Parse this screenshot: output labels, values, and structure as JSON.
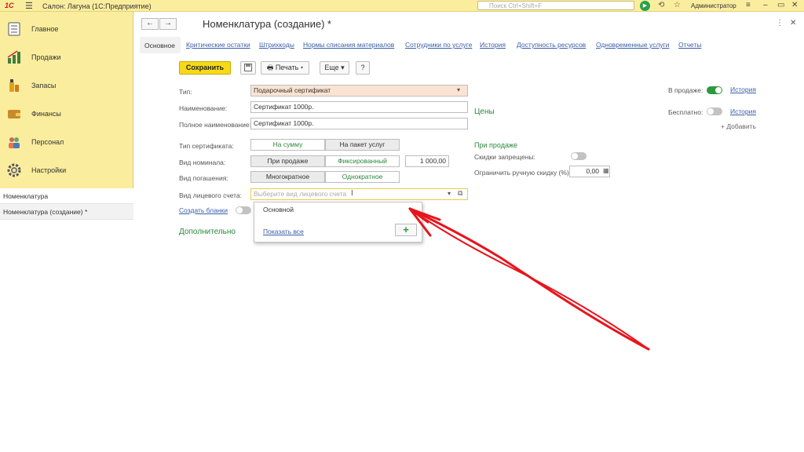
{
  "app": {
    "logo": "1С",
    "title": "Салон: Лагуна  (1С:Предприятие)",
    "search_placeholder": "Поиск Ctrl+Shift+F",
    "user": "Администратор"
  },
  "sidebar": {
    "items": [
      {
        "label": "Главное",
        "icon": "list-icon"
      },
      {
        "label": "Продажи",
        "icon": "bar-chart-icon"
      },
      {
        "label": "Запасы",
        "icon": "bottle-icon"
      },
      {
        "label": "Финансы",
        "icon": "wallet-icon"
      },
      {
        "label": "Персонал",
        "icon": "people-icon"
      },
      {
        "label": "Настройки",
        "icon": "gear-icon"
      }
    ],
    "open_windows": [
      {
        "label": "Номенклатура",
        "active": false
      },
      {
        "label": "Номенклатура (создание) *",
        "active": true
      }
    ]
  },
  "form": {
    "title": "Номенклатура (создание) *",
    "tabs": [
      "Основное",
      "Критические остатки",
      "Штрихкоды",
      "Нормы списания материалов",
      "Сотрудники по услуге",
      "История",
      "Доступность ресурсов",
      "Одновременные услуги",
      "Отчеты"
    ],
    "toolbar": {
      "save": "Сохранить",
      "print": "Печать",
      "more": "Еще",
      "help": "?"
    },
    "fields": {
      "type_label": "Тип:",
      "type_value": "Подарочный сертификат",
      "name_label": "Наименование:",
      "name_value": "Сертификат 1000р.",
      "fullname_label": "Полное наименование:",
      "fullname_value": "Сертификат 1000р.",
      "cert_type_label": "Тип сертификата:",
      "cert_type_options": [
        "На сумму",
        "На пакет услуг"
      ],
      "nominal_label": "Вид номинала:",
      "nominal_options": [
        "При продаже",
        "Фиксированный"
      ],
      "nominal_value": "1 000,00",
      "redeem_label": "Вид погашения:",
      "redeem_options": [
        "Многократное",
        "Однократное"
      ],
      "account_label": "Вид лицевого счета:",
      "account_placeholder": "Выберите вид лицевого счета",
      "create_blanks": "Создать бланки",
      "additional": "Дополнительно"
    },
    "right": {
      "on_sale_label": "В продаже:",
      "on_sale_on": true,
      "history": "История",
      "free_label": "Бесплатно:",
      "free_on": false,
      "add": "+ Добавить",
      "prices": "Цены",
      "at_sale": "При продаже",
      "discounts_forbidden": "Скидки запрещены:",
      "limit_discount": "Ограничить ручную скидку (%):",
      "limit_value": "0,00"
    },
    "dropdown": {
      "option": "Основной",
      "show_all": "Показать все",
      "add": "+"
    }
  },
  "colors": {
    "accent_yellow": "#fbed9e",
    "save_button": "#f6d917",
    "green": "#2a8a3a",
    "link": "#3a5ea8",
    "annotation_arrow": "#e8141c"
  }
}
